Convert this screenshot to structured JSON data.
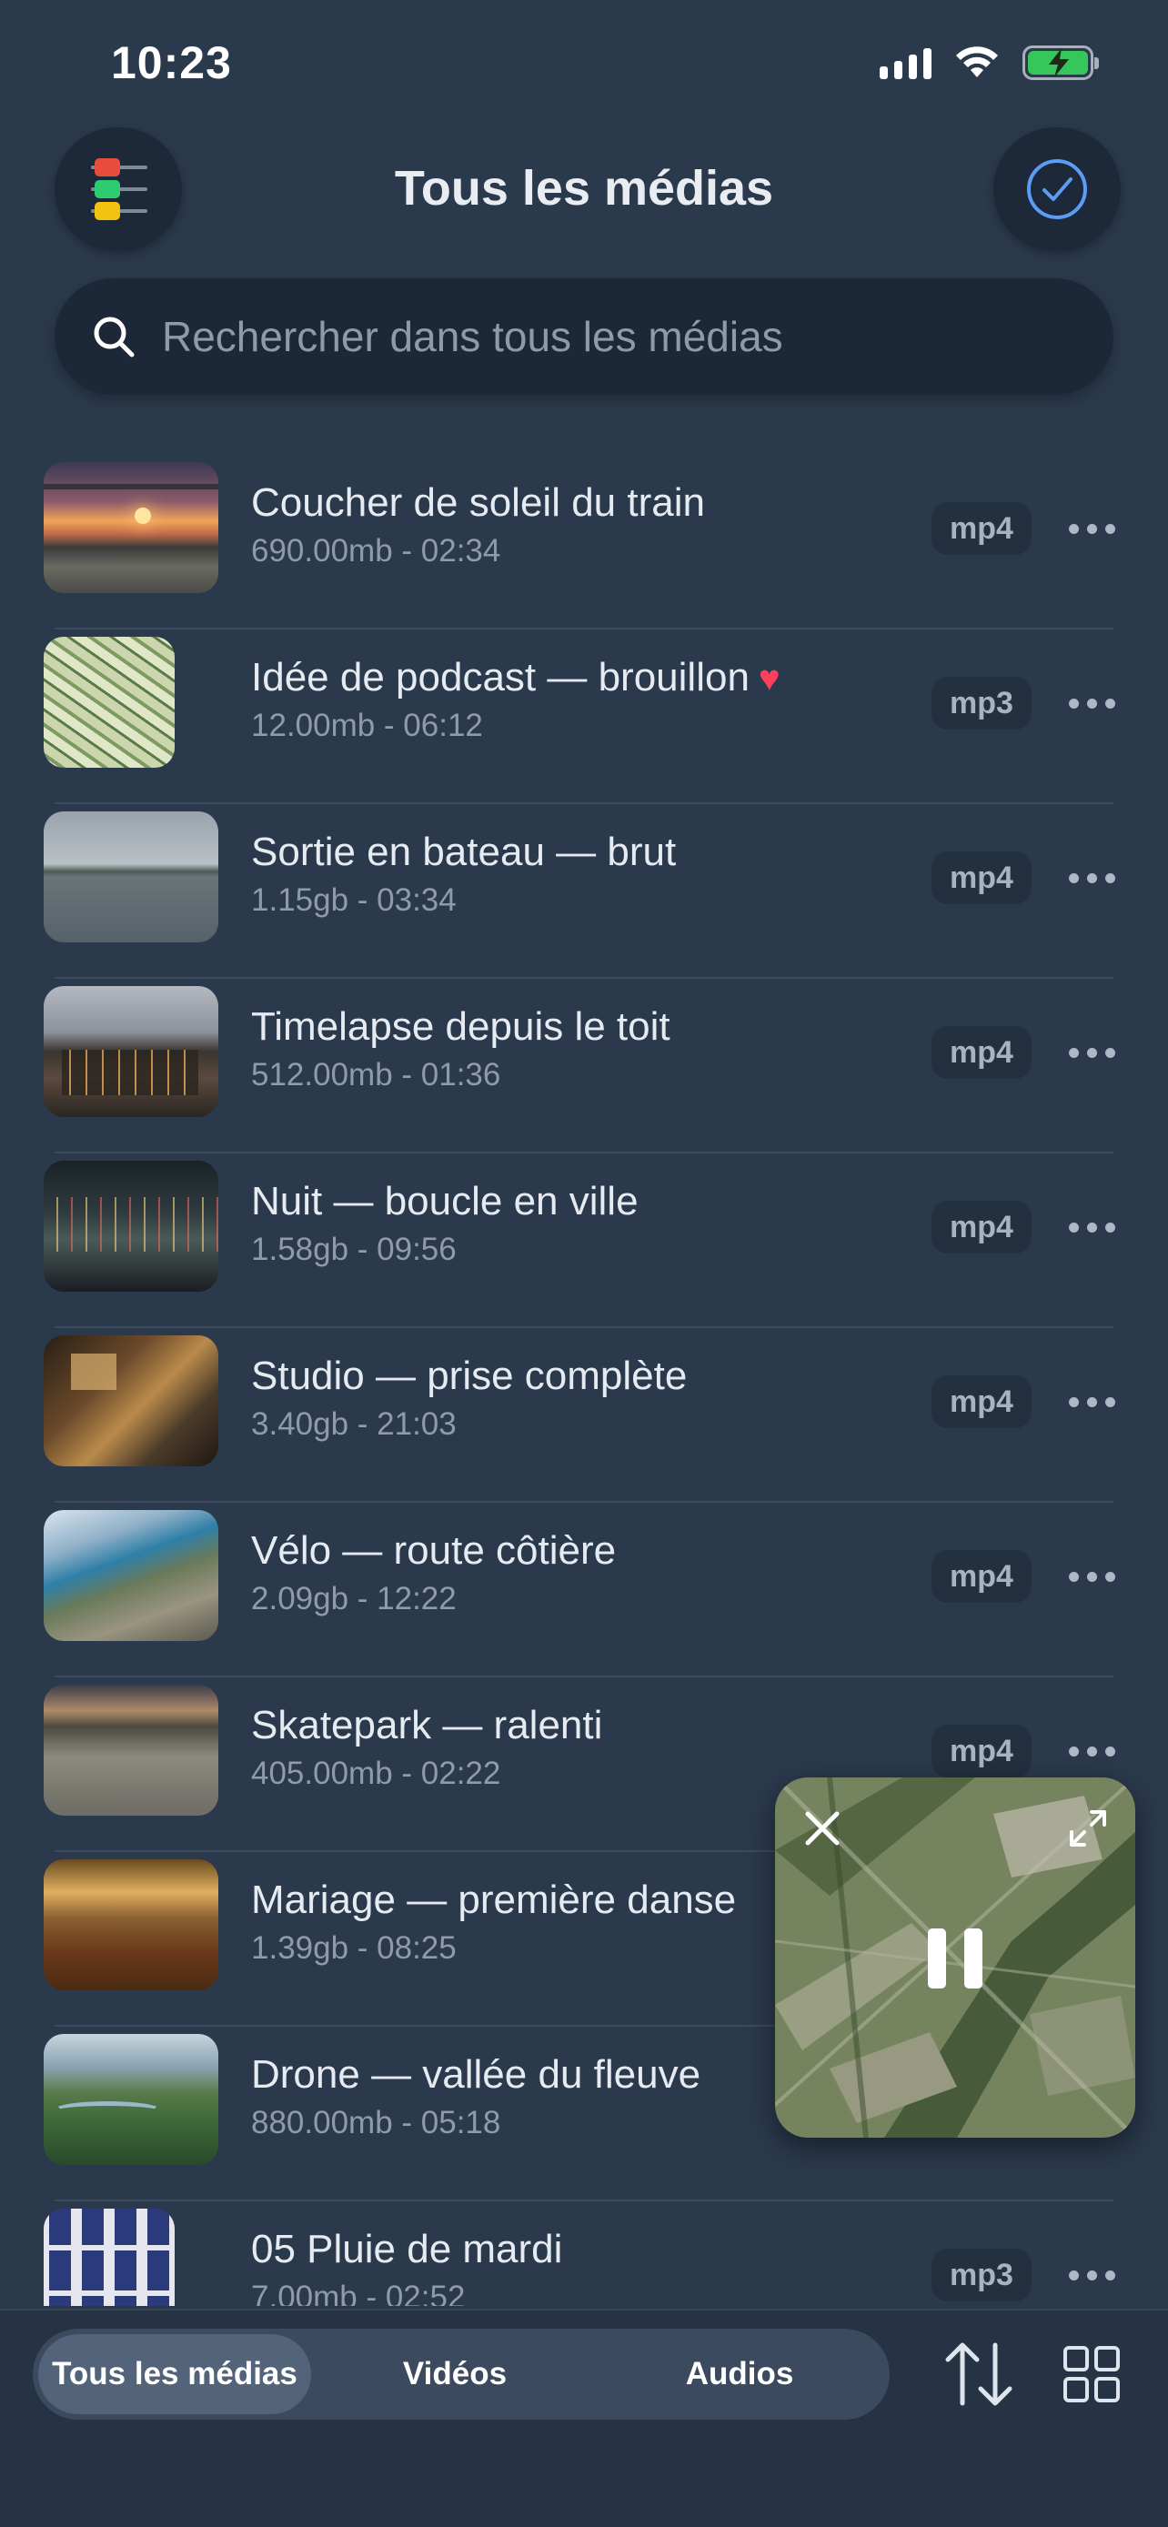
{
  "status_bar": {
    "time": "10:23"
  },
  "header": {
    "title": "Tous les médias"
  },
  "search": {
    "placeholder": "Rechercher dans tous les médias"
  },
  "media": [
    {
      "title": "Coucher de soleil du train",
      "meta": "690.00mb - 02:34",
      "format": "mp4",
      "favorite": false
    },
    {
      "title": "Idée de podcast — brouillon",
      "meta": "12.00mb - 06:12",
      "format": "mp3",
      "favorite": true
    },
    {
      "title": "Sortie en bateau — brut",
      "meta": "1.15gb - 03:34",
      "format": "mp4",
      "favorite": false
    },
    {
      "title": "Timelapse depuis le toit",
      "meta": "512.00mb - 01:36",
      "format": "mp4",
      "favorite": false
    },
    {
      "title": "Nuit — boucle en ville",
      "meta": "1.58gb - 09:56",
      "format": "mp4",
      "favorite": false
    },
    {
      "title": "Studio — prise complète",
      "meta": "3.40gb - 21:03",
      "format": "mp4",
      "favorite": false
    },
    {
      "title": "Vélo — route côtière",
      "meta": "2.09gb - 12:22",
      "format": "mp4",
      "favorite": false
    },
    {
      "title": "Skatepark — ralenti",
      "meta": "405.00mb - 02:22",
      "format": "mp4",
      "favorite": false
    },
    {
      "title": "Mariage — première danse",
      "meta": "1.39gb - 08:25",
      "format": "",
      "favorite": false
    },
    {
      "title": "Drone — vallée du fleuve",
      "meta": "880.00mb - 05:18",
      "format": "",
      "favorite": false
    },
    {
      "title": "05 Pluie de mardi",
      "meta": "7.00mb - 02:52",
      "format": "mp3",
      "favorite": false
    }
  ],
  "tabs": [
    {
      "label": "Tous les médias",
      "active": true
    },
    {
      "label": "Vidéos",
      "active": false
    },
    {
      "label": "Audios",
      "active": false
    }
  ],
  "colors": {
    "background": "#2a394c",
    "accent": "#5b9cf5",
    "heart": "#ff3f5e",
    "battery": "#35c759"
  },
  "icons": [
    "menu-icon",
    "checkmark-circle-icon",
    "search-icon",
    "more-icon",
    "close-icon",
    "expand-icon",
    "pause-icon",
    "sort-icon",
    "grid-icon"
  ]
}
